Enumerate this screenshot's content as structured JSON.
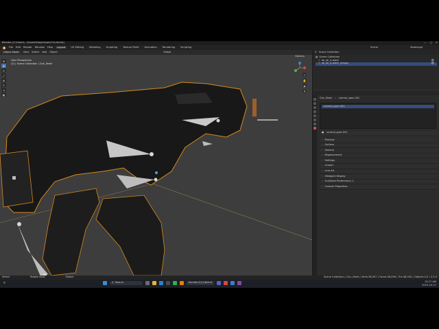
{
  "window": {
    "title": "Blender [C:\\Users\\...\\Saved\\Projects\\aks74u.blend]",
    "controls": [
      "—",
      "□",
      "✕"
    ]
  },
  "menubar": {
    "items": [
      "File",
      "Edit",
      "Render",
      "Window",
      "Help"
    ],
    "workspaces": [
      "Layout",
      "UV Editing",
      "Modeling",
      "Sculpting",
      "Texture Paint",
      "Animation",
      "Rendering",
      "Scripting"
    ],
    "active_workspace": "Layout",
    "scene_label": "Scene",
    "view_layer_label": "ViewLayer"
  },
  "viewport_header": {
    "mode": "Object Mode",
    "menus": [
      "View",
      "Select",
      "Add",
      "Object"
    ],
    "transform": "Global",
    "options_label": "Options"
  },
  "viewport": {
    "perspective": "User Perspective",
    "collection_info": "(2) | Scene Collection | Gun_Rewt",
    "tools": [
      "cursor",
      "move",
      "rotate",
      "scale",
      "transform",
      "annotate",
      "measure",
      "add"
    ],
    "gizmo_axes": [
      "X",
      "Y",
      "Z"
    ]
  },
  "outliner": {
    "header": "Scene Collection",
    "rows": [
      {
        "label": "Scene Collection",
        "selected": false
      },
      {
        "label": "ak_ak_rt.aldrk",
        "selected": false
      },
      {
        "label": "ak_ak_rt.aldrk_mesgn",
        "selected": true
      }
    ]
  },
  "properties": {
    "breadcrumb": [
      "Gun_Rewt",
      "normal_spec.001"
    ],
    "material_slot": "normal_spec.001",
    "material_name": "normal_spec.001",
    "panels": [
      "Preview",
      "Surface",
      "Volume",
      "Displacement",
      "Settings",
      "Lineart",
      "Line Art",
      "Viewport Display",
      "Fur/Dead Preferred(c) 1",
      "Custom Properties"
    ]
  },
  "statusbar": {
    "left": [
      "Select",
      "Rotate View",
      "Object"
    ],
    "right": "Scene Collection | Gun_Rewt | Verts:38,097 | Faces:38,096 | Tris:48,000 | Objects:1/2 | 3.3.0"
  },
  "taskbar": {
    "search_placeholder": "Search",
    "active_window_label": "blender(2)(1)blend",
    "time": "10:17 AM",
    "date": "2023-10-17",
    "colors": {
      "background": "#1c1f26",
      "accent": "#4772b3"
    }
  }
}
